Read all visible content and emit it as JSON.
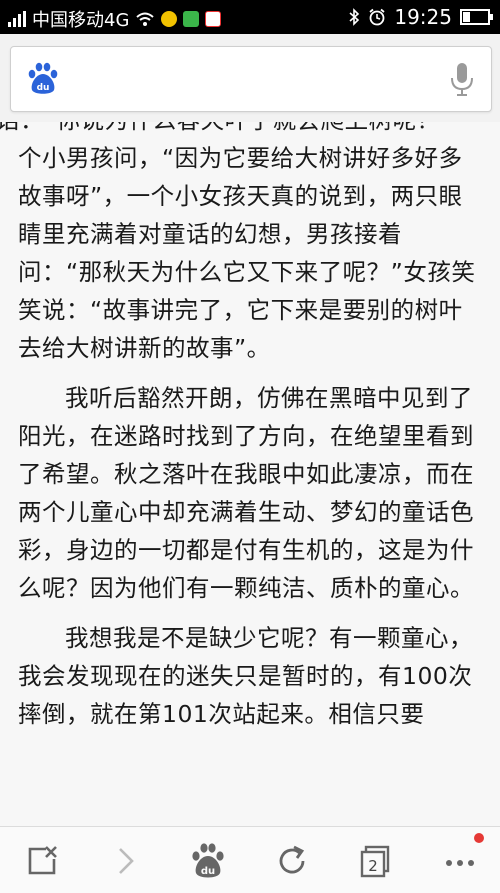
{
  "status_bar": {
    "carrier": "中国移动4G",
    "time": "19:25",
    "battery_level": 0.3
  },
  "search": {
    "logo_text": "du"
  },
  "article": {
    "paragraphs": [
      "一段对话：“你说为什么春天叶子就会爬上树呢？”一个小男孩问，“因为它要给大树讲好多好多故事呀”，一个小女孩天真的说到，两只眼睛里充满着对童话的幻想，男孩接着问：“那秋天为什么它又下来了呢？”女孩笑笑说：“故事讲完了，它下来是要别的树叶去给大树讲新的故事”。",
      "我听后豁然开朗，仿佛在黑暗中见到了阳光，在迷路时找到了方向，在绝望里看到了希望。秋之落叶在我眼中如此凄凉，而在两个儿童心中却充满着生动、梦幻的童话色彩，身边的一切都是付有生机的，这是为什么呢？因为他们有一颗纯洁、质朴的童心。",
      "我想我是不是缺少它呢？有一颗童心，我会发现现在的迷失只是暂时的，有100次摔倒，就在第101次站起来。相信只要"
    ]
  },
  "toolbar": {
    "tab_count": "2",
    "home_logo_text": "du"
  },
  "colors": {
    "baidu_blue": "#2b63d9",
    "notification_red": "#e53935"
  }
}
